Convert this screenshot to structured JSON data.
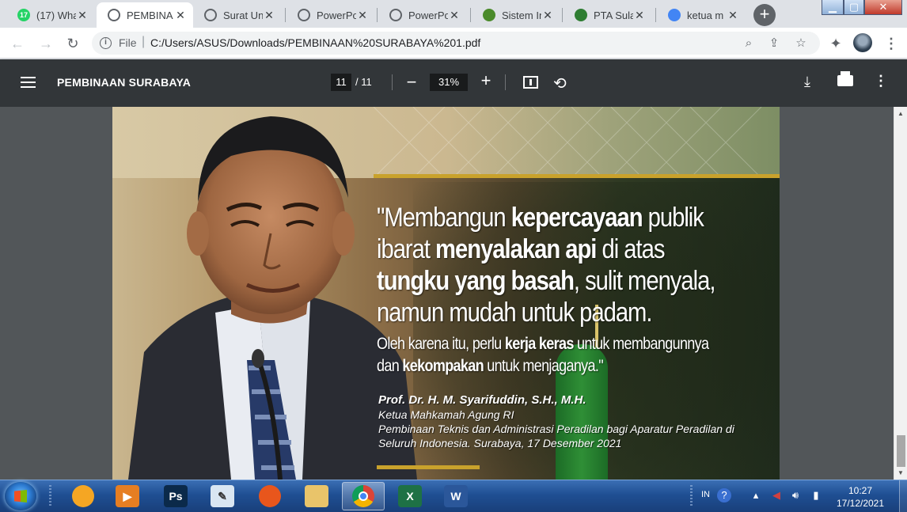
{
  "browser": {
    "tabs": [
      {
        "title": "(17) Wha",
        "favicon": "whatsapp-icon",
        "favicon_text": "17",
        "color": "#25d366",
        "active": false
      },
      {
        "title": "PEMBINA",
        "favicon": "globe-icon",
        "color": "#5f6368",
        "active": true
      },
      {
        "title": "Surat Un",
        "favicon": "globe-icon",
        "color": "#5f6368",
        "active": false
      },
      {
        "title": "PowerPo",
        "favicon": "globe-icon",
        "color": "#5f6368",
        "active": false
      },
      {
        "title": "PowerPo",
        "favicon": "globe-icon",
        "color": "#5f6368",
        "active": false
      },
      {
        "title": "Sistem In",
        "favicon": "sistem-icon",
        "color": "#4a8a2a",
        "active": false
      },
      {
        "title": "PTA Sula",
        "favicon": "pta-logo-icon",
        "color": "#2e7d32",
        "active": false
      },
      {
        "title": "ketua m",
        "favicon": "google-icon",
        "color": "#4285f4",
        "active": false
      }
    ],
    "new_tab_label": "+",
    "scheme_label": "File",
    "url": "C:/Users/ASUS/Downloads/PEMBINAAN%20SURABAYA%201.pdf"
  },
  "pdf_viewer": {
    "title": "PEMBINAAN SURABAYA",
    "current_page": "11",
    "total_pages": "/ 11",
    "zoom": "31%"
  },
  "document": {
    "quote_lines": [
      {
        "pre": "\"Membangun ",
        "bold": "kepercayaan",
        "post": " publik"
      },
      {
        "pre": "ibarat ",
        "bold": "menyalakan api",
        "post": " di atas"
      },
      {
        "pre": "",
        "bold": "tungku yang basah",
        "post": ", sulit menyala,"
      },
      {
        "pre": "namun mudah  untuk padam.",
        "bold": "",
        "post": ""
      }
    ],
    "quote_small_lines": [
      {
        "pre": "Oleh karena itu, perlu ",
        "bold": "kerja keras",
        "post": " untuk membangunnya"
      },
      {
        "pre": "dan ",
        "bold": "kekompakan",
        "post": " untuk menjaganya.\""
      }
    ],
    "attribution": {
      "name": "Prof. Dr. H. M. Syarifuddin, S.H., M.H.",
      "role": "Ketua Mahkamah Agung RI",
      "event_line1": "Pembinaan Teknis dan Administrasi Peradilan bagi Aparatur Peradilan di",
      "event_line2": "Seluruh Indonesia. Surabaya, 17 Desember 2021"
    }
  },
  "taskbar": {
    "apps": [
      {
        "name": "chrome-canary-icon",
        "color": "#f5a623",
        "text": "",
        "active": false
      },
      {
        "name": "media-player-icon",
        "color": "#e67e22",
        "text": "▶",
        "active": false
      },
      {
        "name": "photoshop-icon",
        "color": "#0b2a4a",
        "text": "Ps",
        "active": false
      },
      {
        "name": "notepad-icon",
        "color": "#d9e6f2",
        "text": "✎",
        "active": false
      },
      {
        "name": "firefox-icon",
        "color": "#e8561c",
        "text": "",
        "active": false
      },
      {
        "name": "file-explorer-icon",
        "color": "#e9c46a",
        "text": "",
        "active": false
      },
      {
        "name": "chrome-icon",
        "color": "#ffffff",
        "text": "",
        "active": true
      },
      {
        "name": "excel-icon",
        "color": "#1e7145",
        "text": "X",
        "active": false
      },
      {
        "name": "word-icon",
        "color": "#2b579a",
        "text": "W",
        "active": false
      }
    ],
    "language": "IN",
    "time": "10:27",
    "date": "17/12/2021"
  }
}
